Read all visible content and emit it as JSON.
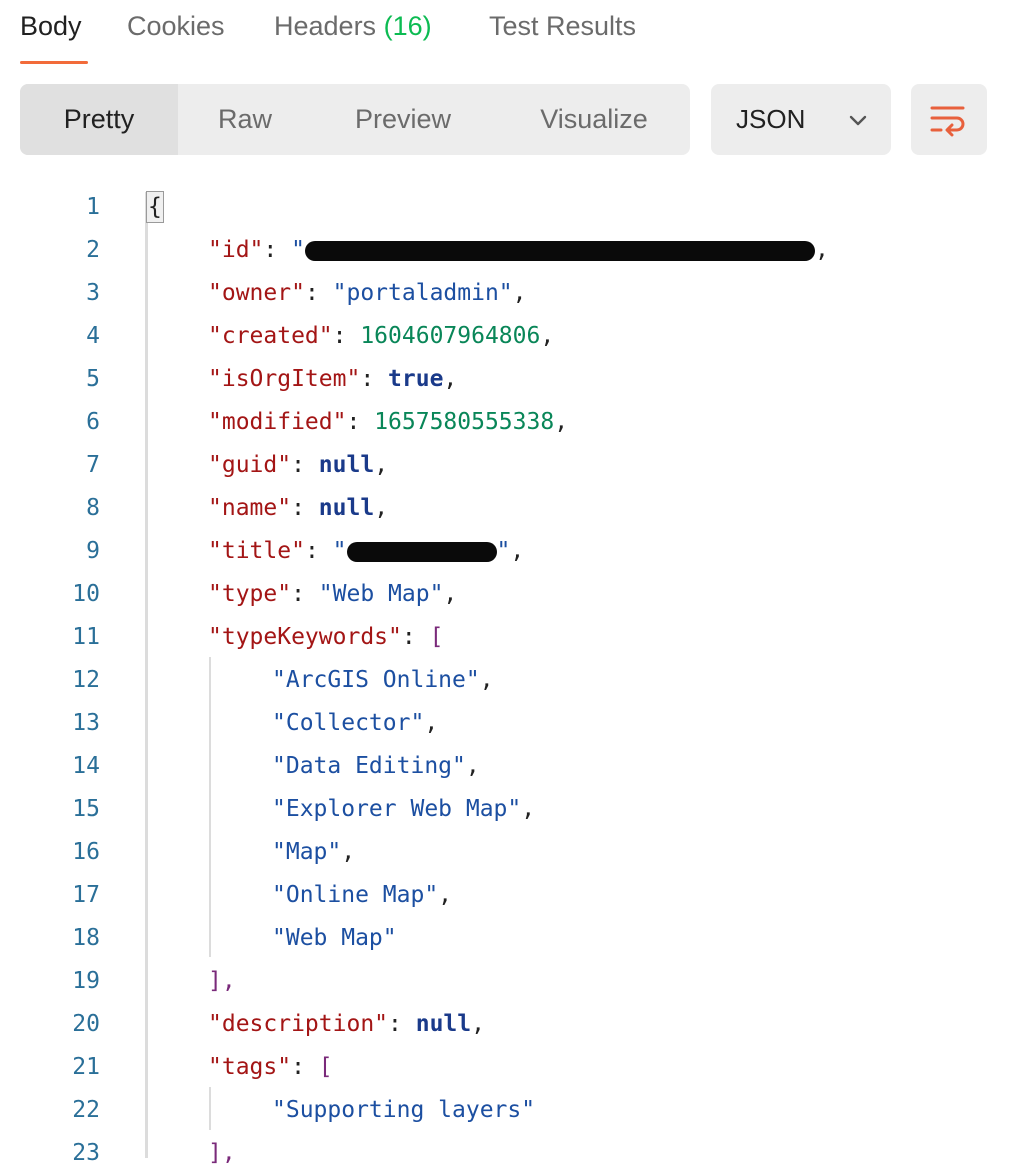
{
  "tabs": {
    "body": "Body",
    "cookies": "Cookies",
    "headers": "Headers",
    "headers_count": "(16)",
    "test_results": "Test Results"
  },
  "view": {
    "pretty": "Pretty",
    "raw": "Raw",
    "preview": "Preview",
    "visualize": "Visualize",
    "format": "JSON"
  },
  "icons": {
    "chevron": "chevron-down-icon",
    "wrap": "word-wrap-icon"
  },
  "colors": {
    "active_tab_underline": "#f26b3a",
    "header_count": "#0cbb52",
    "json_key": "#a31515",
    "json_string": "#1c4fa1",
    "json_number": "#098658",
    "line_number": "#2a6f98"
  },
  "code": {
    "line_numbers": [
      "1",
      "2",
      "3",
      "4",
      "5",
      "6",
      "7",
      "8",
      "9",
      "10",
      "11",
      "12",
      "13",
      "14",
      "15",
      "16",
      "17",
      "18",
      "19",
      "20",
      "21",
      "22",
      "23"
    ],
    "open_brace": "{",
    "id_key": "\"id\"",
    "owner_key": "\"owner\"",
    "owner_value": "\"portaladmin\"",
    "created_key": "\"created\"",
    "created_value": "1604607964806",
    "isOrgItem_key": "\"isOrgItem\"",
    "isOrgItem_value": "true",
    "modified_key": "\"modified\"",
    "modified_value": "1657580555338",
    "guid_key": "\"guid\"",
    "guid_value": "null",
    "name_key": "\"name\"",
    "name_value": "null",
    "title_key": "\"title\"",
    "type_key": "\"type\"",
    "type_value": "\"Web Map\"",
    "typeKeywords_key": "\"typeKeywords\"",
    "typeKeywords": [
      "\"ArcGIS Online\"",
      "\"Collector\"",
      "\"Data Editing\"",
      "\"Explorer Web Map\"",
      "\"Map\"",
      "\"Online Map\"",
      "\"Web Map\""
    ],
    "description_key": "\"description\"",
    "description_value": "null",
    "tags_key": "\"tags\"",
    "tags": [
      "\"Supporting layers\""
    ],
    "close_array": "],"
  }
}
